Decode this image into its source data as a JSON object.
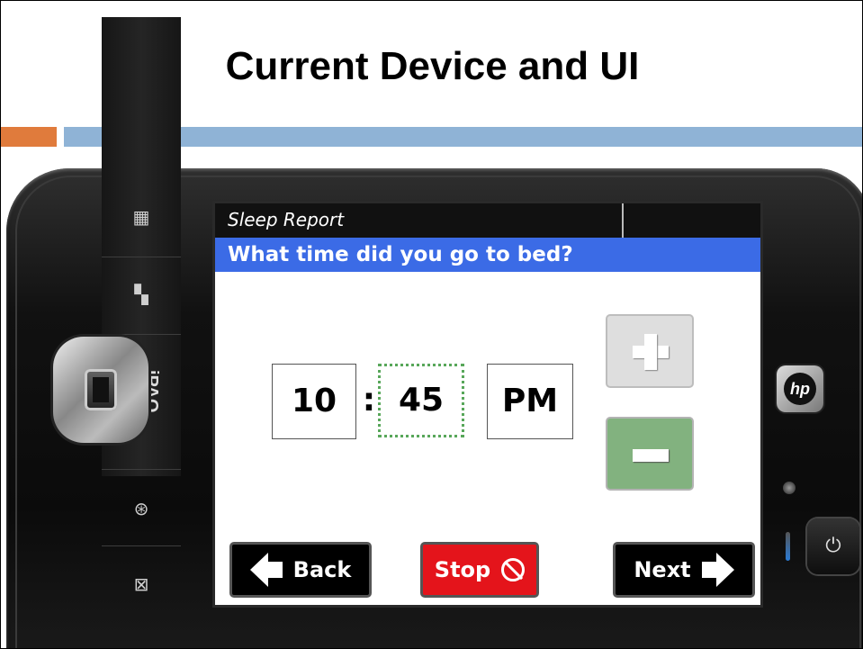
{
  "slide": {
    "title": "Current Device and UI"
  },
  "device": {
    "brand": "iPAQ",
    "logo_text": "hp",
    "hardware_icons": [
      "calendar-grid-icon",
      "windows-start-icon",
      "ok-icon",
      "envelope-icon",
      "power-icon"
    ]
  },
  "app": {
    "title": "Sleep Report",
    "question": "What time did you go to bed?",
    "time": {
      "hour": "10",
      "separator": ":",
      "minute": "45",
      "ampm": "PM"
    },
    "buttons": {
      "back": "Back",
      "stop": "Stop",
      "next": "Next"
    }
  },
  "colors": {
    "question_bar": "#3b6be6",
    "stop_button": "#e4141b",
    "minus_button": "#82b27f",
    "plus_button": "#dedede",
    "accent_orange": "#e07b3c",
    "accent_blue": "#8fb3d6"
  }
}
